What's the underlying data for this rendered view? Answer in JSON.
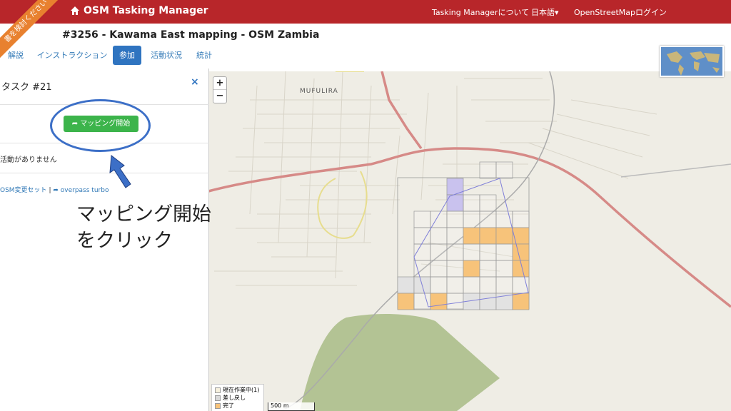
{
  "nav": {
    "brand": "OSM Tasking Manager",
    "about": "Tasking Managerについて",
    "language": "日本語▾",
    "login": "OpenStreetMapログイン",
    "ribbon": "書を検討ください"
  },
  "project": {
    "title": "#3256 - Kawama East mapping - OSM Zambia"
  },
  "tabs": [
    {
      "label": "解説"
    },
    {
      "label": "インストラクション"
    },
    {
      "label": "参加"
    },
    {
      "label": "活動状況"
    },
    {
      "label": "統計"
    }
  ],
  "task_panel": {
    "title": "タスク #21",
    "close": "×",
    "start_button": "➦ マッピング開始",
    "activity": "活動がありません",
    "link_osm": "OSM変更セット",
    "separator": "|",
    "link_overpass": "➦ overpass turbo"
  },
  "map": {
    "zoom_in": "+",
    "zoom_out": "−",
    "place": "MUFULIRA",
    "scale": "500 m",
    "legend": [
      {
        "label": "現在作業中(1)",
        "color": "#f7f1de"
      },
      {
        "label": "差し戻し",
        "color": "#d9d9d9"
      },
      {
        "label": "完了",
        "color": "#f7c37a"
      }
    ]
  },
  "annotation": {
    "line1": "マッピング開始",
    "line2": "をクリック"
  },
  "colors": {
    "nav": "#b8262a",
    "accent": "#2f74c0",
    "button": "#3cb44b",
    "done": "#f7c37a"
  }
}
